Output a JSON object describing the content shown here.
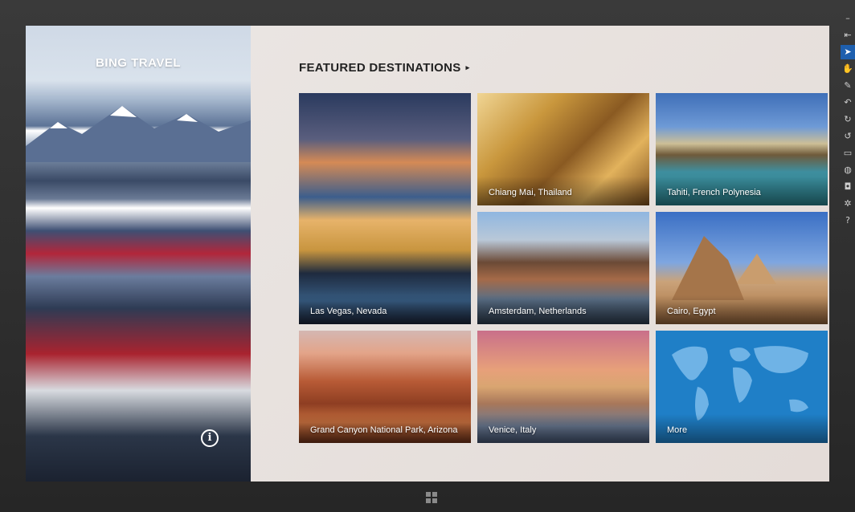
{
  "hero": {
    "title": "BING TRAVEL"
  },
  "featured": {
    "title": "FEATURED DESTINATIONS",
    "chevron": "▸",
    "tiles": [
      {
        "label": "Las Vegas, Nevada"
      },
      {
        "label": "Chiang Mai, Thailand"
      },
      {
        "label": "Tahiti, French Polynesia"
      },
      {
        "label": "Amsterdam, Netherlands"
      },
      {
        "label": "Cairo, Egypt"
      },
      {
        "label": "Grand Canyon National Park, Arizona"
      },
      {
        "label": "Venice, Italy"
      },
      {
        "label": "More"
      }
    ]
  },
  "icons": {
    "info": "i",
    "charms": [
      "minimize-icon",
      "back-icon",
      "pointer-icon",
      "hand-icon",
      "pen-icon",
      "rotate-left-icon",
      "rotate-right-icon",
      "rotate-icon",
      "monitor-icon",
      "globe-icon",
      "camera-icon",
      "settings-icon",
      "help-icon"
    ]
  },
  "colors": {
    "content_bg": "#e9e4e1",
    "more_tile": "#1f7fc7",
    "charm_active": "#1e5fae"
  }
}
